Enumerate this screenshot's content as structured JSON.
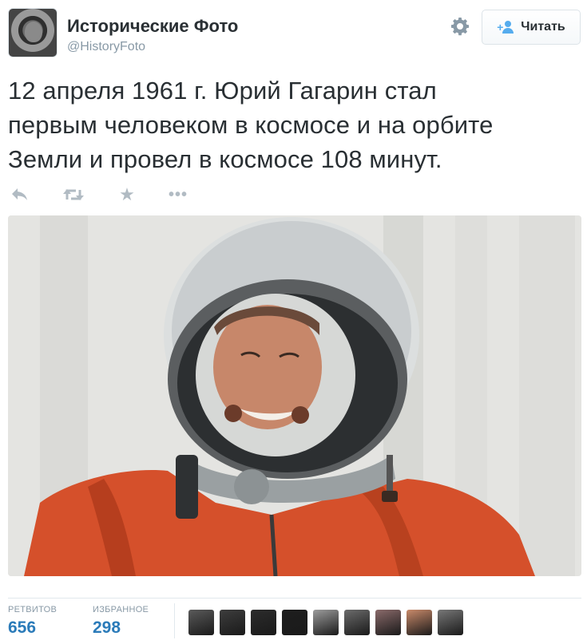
{
  "account": {
    "display_name": "Исторические Фото",
    "handle": "@HistoryFoto",
    "avatar_icon": "profile-photo-cosmonaut"
  },
  "header": {
    "settings_icon": "gear-icon",
    "follow_label": "Читать",
    "follow_icon": "follow-user-plus-icon"
  },
  "tweet": {
    "lines": [
      "12 апреля 1961 г.  Юрий Гагарин стал",
      "первым человеком в космосе и на орбите",
      "Земли и провел в космосе 108 минут."
    ]
  },
  "actions": {
    "reply_icon": "reply-icon",
    "retweet_icon": "retweet-icon",
    "favorite_icon": "star-icon",
    "more_glyph": "•••"
  },
  "media": {
    "type": "photo-cosmonaut-in-helmet"
  },
  "stats": {
    "retweets_label": "РЕТВИТОВ",
    "retweets_value": "656",
    "favorites_label": "ИЗБРАННОЕ",
    "favorites_value": "298"
  },
  "favoriters": [
    {
      "color": "#5a5a5a"
    },
    {
      "color": "#3d3d3d"
    },
    {
      "color": "#2c2c2c"
    },
    {
      "color": "#1e1e1e"
    },
    {
      "color": "#9c9c9c"
    },
    {
      "color": "#6b6b6b"
    },
    {
      "color": "#8a6a6a"
    },
    {
      "color": "#c98a6a"
    },
    {
      "color": "#777777"
    }
  ],
  "colors": {
    "accent": "#55acee",
    "link": "#2b7bb9",
    "muted": "#8899a6",
    "spacesuit": "#d5502b"
  }
}
